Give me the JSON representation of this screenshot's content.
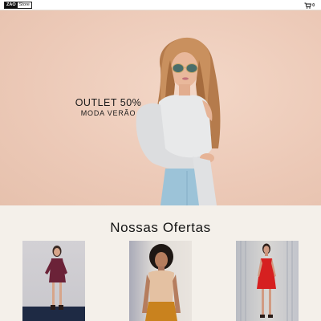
{
  "header": {
    "logo_mark": "ZAO",
    "logo_text": "Store",
    "cart_icon": "cart-icon",
    "cart_count": "0"
  },
  "hero": {
    "line1": "OUTLET 50%",
    "line2": "MODA VERÃO",
    "background_color": "#efcfbf"
  },
  "offers": {
    "title": "Nossas Ofertas",
    "products": [
      {
        "dress_color": "#6b2238"
      },
      {
        "top_color": "#e4c1a2",
        "skirt_color": "#c9821e"
      },
      {
        "dress_color": "#d62020"
      }
    ]
  }
}
